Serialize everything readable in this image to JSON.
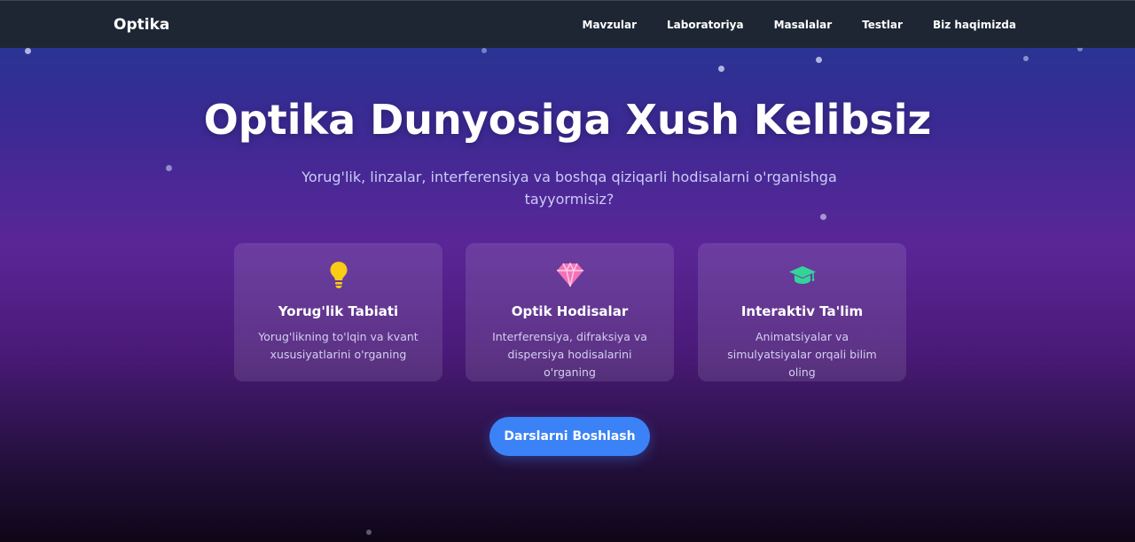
{
  "navbar": {
    "brand": "Optika",
    "links": [
      "Mavzular",
      "Laboratoriya",
      "Masalalar",
      "Testlar",
      "Biz haqimizda"
    ]
  },
  "hero": {
    "title": "Optika Dunyosiga Xush Kelibsiz",
    "subtitle": "Yorug'lik, linzalar, interferensiya va boshqa qiziqarli hodisalarni o'rganishga tayyormisiz?"
  },
  "cards": [
    {
      "icon": "lightbulb-icon",
      "icon_color": "#facc15",
      "title": "Yorug'lik Tabiati",
      "description": "Yorug'likning to'lqin va kvant xususiyatlarini o'rganing"
    },
    {
      "icon": "gem-icon",
      "icon_color": "#f472b6",
      "title": "Optik Hodisalar",
      "description": "Interferensiya, difraksiya va dispersiya hodisalarini o'rganing"
    },
    {
      "icon": "graduation-cap-icon",
      "icon_color": "#34d399",
      "title": "Interaktiv Ta'lim",
      "description": "Animatsiyalar va simulyatsiyalar orqali bilim oling"
    }
  ],
  "cta": {
    "label": "Darslarni Boshlash"
  },
  "colors": {
    "navbar": "#1e2634",
    "button": "#3b82f6",
    "gradient_top": "#1f3a93",
    "gradient_mid": "#5a2697",
    "gradient_bottom": "#0f0618"
  }
}
